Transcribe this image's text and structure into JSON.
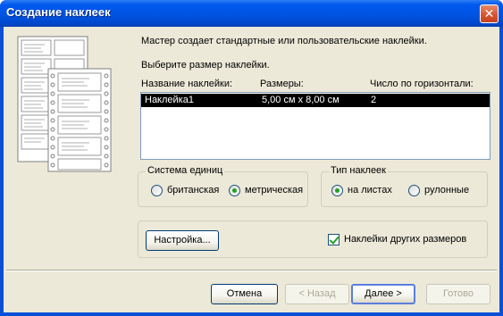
{
  "window": {
    "title": "Создание наклеек",
    "close_glyph": "✕"
  },
  "intro_text": "Мастер создает стандартные или пользовательские наклейки.",
  "choose_text": "Выберите размер наклейки.",
  "list": {
    "headers": [
      "Название наклейки:",
      "Размеры:",
      "Число по горизонтали:"
    ],
    "rows": [
      {
        "name": "Наклейка1",
        "size": "5,00 см x 8,00 см",
        "count": "2",
        "selected": true
      }
    ]
  },
  "units": {
    "label": "Система единиц",
    "options": [
      "британская",
      "метрическая"
    ],
    "selected": "метрическая"
  },
  "label_type": {
    "label": "Тип наклеек",
    "options": [
      "на листах",
      "рулонные"
    ],
    "selected": "на листах"
  },
  "customize_label": "Настройка...",
  "other_sizes": {
    "label": "Наклейки других размеров",
    "checked": true
  },
  "buttons": {
    "cancel": "Отмена",
    "back": "< Назад",
    "next": "Далее >",
    "finish": "Готово"
  },
  "colors": {
    "selection": "#000000",
    "radio_on": "#21a121",
    "title_bar": "#0054e3"
  }
}
